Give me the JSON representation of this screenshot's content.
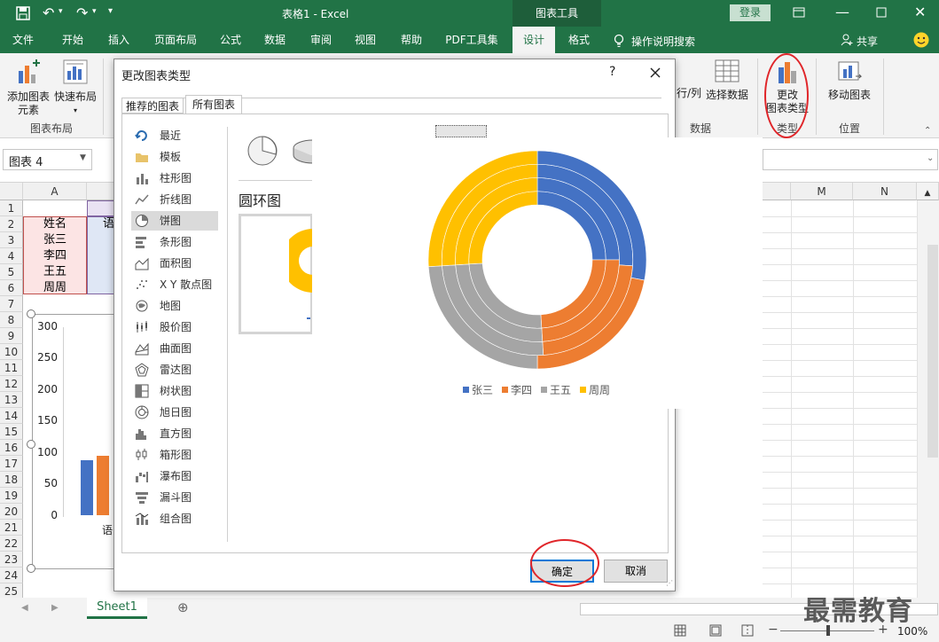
{
  "window": {
    "title": "表格1  -  Excel",
    "context_tab": "图表工具",
    "login": "登录"
  },
  "ribbon_tabs": [
    "文件",
    "开始",
    "插入",
    "页面布局",
    "公式",
    "数据",
    "审阅",
    "视图",
    "帮助",
    "PDF工具集",
    "设计",
    "格式"
  ],
  "tell_me": "操作说明搜索",
  "share": "共享",
  "ribbon": {
    "add_element": [
      "添加图表",
      "元素"
    ],
    "quick_layout": "快速布局",
    "group_layout": "图表布局",
    "switch_row_col": "行/列",
    "select_data": "选择数据",
    "group_data": "数据",
    "change_type": [
      "更改",
      "图表类型"
    ],
    "group_type": "类型",
    "move_chart": "移动图表",
    "group_location": "位置"
  },
  "namebox": "图表 4",
  "sheet": {
    "columns": [
      "A",
      "M",
      "N"
    ],
    "rows": [
      "1",
      "2",
      "3",
      "4",
      "5",
      "6",
      "7",
      "8",
      "9",
      "10",
      "11",
      "12",
      "13",
      "14",
      "15",
      "16",
      "17",
      "18",
      "19",
      "20",
      "21",
      "22",
      "23",
      "24",
      "25"
    ],
    "cells": [
      "姓名",
      "张三",
      "李四",
      "王五",
      "周周"
    ],
    "partial_b2": "语",
    "y_axis": [
      "300",
      "250",
      "200",
      "150",
      "100",
      "50",
      "0"
    ],
    "x_partial": "语",
    "tab": "Sheet1",
    "zoom": "100%"
  },
  "dialog": {
    "title": "更改图表类型",
    "help": "?",
    "tabs": [
      "推荐的图表",
      "所有图表"
    ],
    "chart_types": [
      "最近",
      "模板",
      "柱形图",
      "折线图",
      "饼图",
      "条形图",
      "面积图",
      "X Y 散点图",
      "地图",
      "股价图",
      "曲面图",
      "雷达图",
      "树状图",
      "旭日图",
      "直方图",
      "箱形图",
      "瀑布图",
      "漏斗图",
      "组合图"
    ],
    "selected_type_index": 4,
    "subtype_name": "圆环图",
    "ok": "确定",
    "cancel": "取消"
  },
  "chart_data": {
    "type": "pie",
    "variant": "doughnut",
    "rings": 4,
    "series": [
      {
        "name": "张三",
        "color": "#4472c4"
      },
      {
        "name": "李四",
        "color": "#ed7d31"
      },
      {
        "name": "王五",
        "color": "#a5a5a5"
      },
      {
        "name": "周周",
        "color": "#ffc000"
      }
    ],
    "ring_values": [
      [
        25,
        24,
        25,
        26
      ],
      [
        25,
        24,
        25,
        26
      ],
      [
        26,
        23,
        25,
        26
      ],
      [
        28,
        22,
        24,
        26
      ]
    ],
    "legend_position": "bottom"
  },
  "colors": {
    "excel_green": "#217346",
    "annotation_red": "#e0262a",
    "dialog_accent": "#0078d7"
  }
}
